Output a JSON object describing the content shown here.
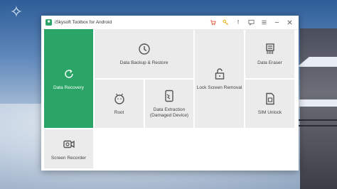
{
  "window": {
    "title": "iSkysoft Toolbox for Android",
    "toolbar_icons": [
      "cart-icon",
      "key-icon",
      "facebook-icon",
      "feedback-icon",
      "menu-icon",
      "minimize-icon",
      "close-icon"
    ],
    "facebook_glyph": "f",
    "accent_color": "#2aa567"
  },
  "tiles": {
    "data_recovery": "Data Recovery",
    "data_backup": "Data Backup & Restore",
    "lock_screen": "Lock Screen Removal",
    "data_eraser": "Data Eraser",
    "root": "Root",
    "data_extraction": "Data Extraction (Damaged Device)",
    "sim_unlock": "SIM Unlock",
    "screen_recorder": "Screen Recorder"
  }
}
